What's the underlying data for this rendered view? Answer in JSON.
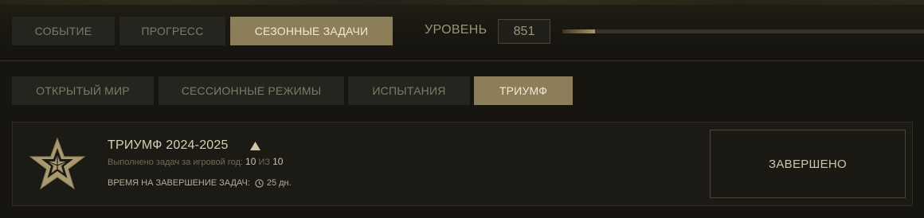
{
  "top_tabs": [
    {
      "label": "СОБЫТИЕ",
      "active": false
    },
    {
      "label": "ПРОГРЕСС",
      "active": false
    },
    {
      "label": "СЕЗОННЫЕ ЗАДАЧИ",
      "active": true
    }
  ],
  "level": {
    "label": "УРОВЕНЬ",
    "value": "851",
    "progress_fraction": 0.09
  },
  "sub_tabs": [
    {
      "label": "ОТКРЫТЫЙ МИР",
      "active": false
    },
    {
      "label": "СЕССИОННЫЕ РЕЖИМЫ",
      "active": false
    },
    {
      "label": "ИСПЫТАНИЯ",
      "active": false
    },
    {
      "label": "ТРИУМФ",
      "active": true
    }
  ],
  "card": {
    "icon": "star-icon",
    "title": "ТРИУМФ 2024-2025",
    "expand_icon": "triangle-up-icon",
    "progress_prefix": "Выполнено задач за игровой год:",
    "progress_done": "10",
    "progress_sep": "ИЗ",
    "progress_total": "10",
    "time_label": "ВРЕМЯ НА ЗАВЕРШЕНИЕ ЗАДАЧ:",
    "time_icon": "clock-icon",
    "time_value": "25 дн.",
    "status": "ЗАВЕРШЕНО"
  },
  "colors": {
    "accent_active_tab": "#8c7e58",
    "inactive_tab": "#252520",
    "background": "#161510"
  }
}
